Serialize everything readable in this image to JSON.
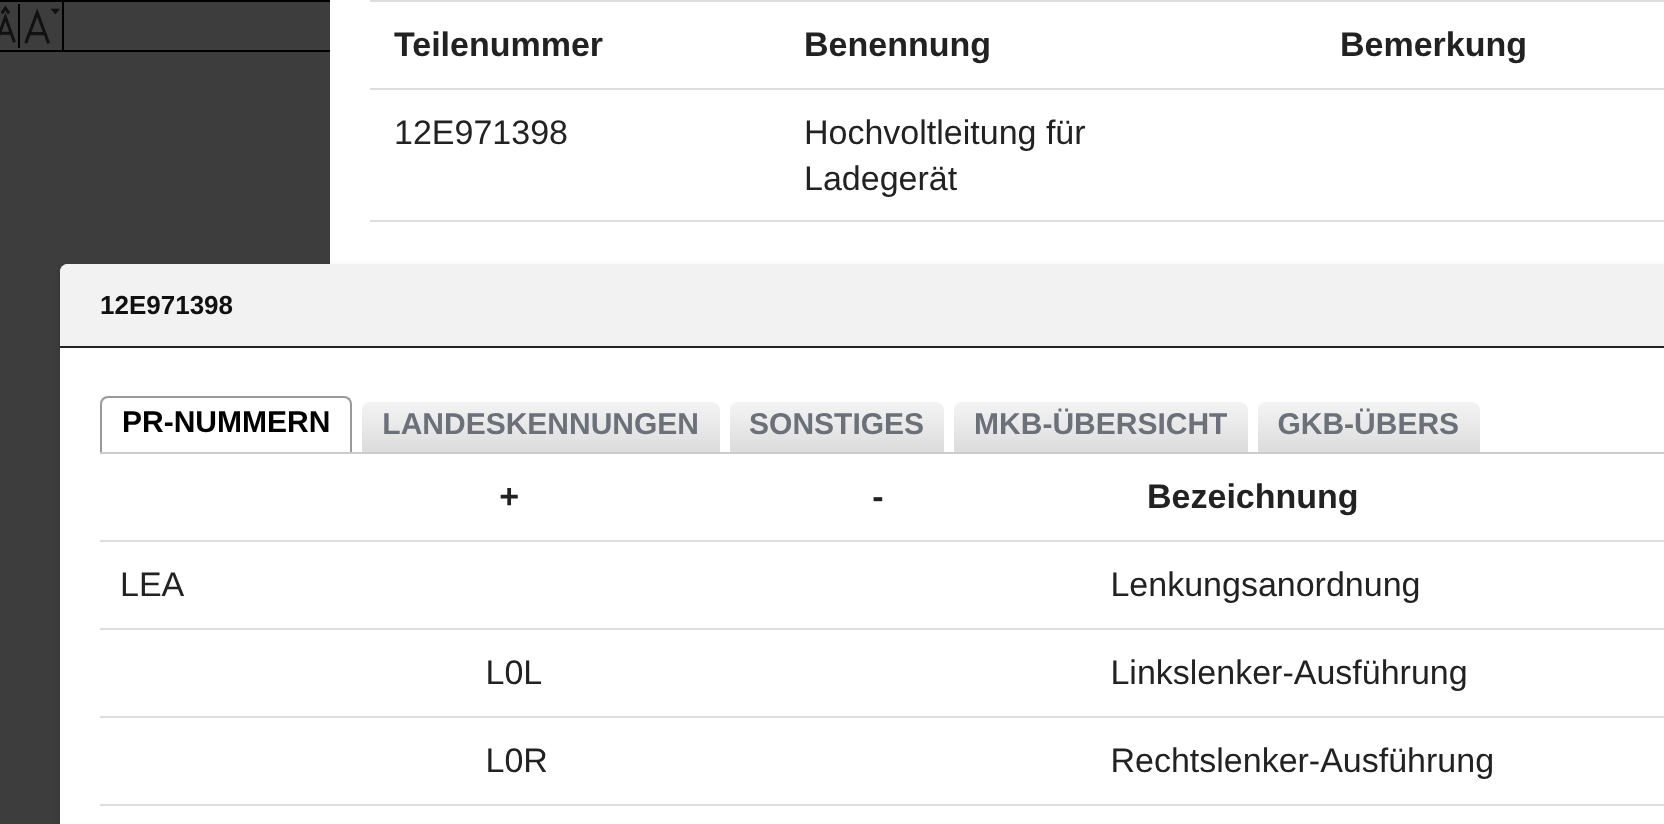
{
  "background_table": {
    "columns": [
      "Teilenummer",
      "Benennung",
      "Bemerkung"
    ],
    "rows": [
      {
        "cells": [
          "12E971398",
          "Hochvoltleitung für Ladegerät",
          ""
        ]
      }
    ]
  },
  "dialog": {
    "title": "12E971398",
    "tabs": [
      {
        "label": "PR-NUMMERN",
        "selected": true
      },
      {
        "label": "LANDESKENNUNGEN",
        "selected": false
      },
      {
        "label": "SONSTIGES",
        "selected": false
      },
      {
        "label": "MKB-ÜBERSICHT",
        "selected": false
      },
      {
        "label": "GKB-ÜBERS",
        "selected": false
      }
    ],
    "table": {
      "columns": [
        "",
        "+",
        "-",
        "Bezeichnung"
      ],
      "rows": [
        {
          "cells": [
            "LEA",
            "",
            "",
            "Lenkungsanordnung"
          ]
        },
        {
          "cells": [
            "",
            "L0L",
            "",
            "Linkslenker-Ausführung"
          ]
        },
        {
          "cells": [
            "",
            "L0R",
            "",
            "Rechtslenker-Ausführung"
          ]
        }
      ]
    }
  }
}
